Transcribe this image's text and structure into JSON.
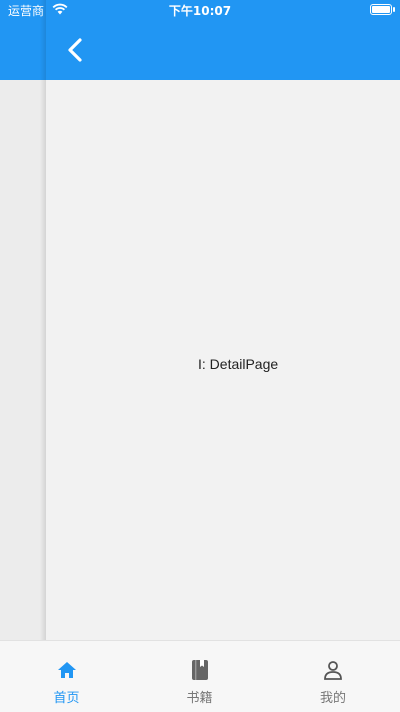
{
  "status_bar": {
    "carrier": "运营商",
    "time": "下午10:07",
    "wifi_icon": "wifi-icon",
    "battery_icon": "battery-icon"
  },
  "app_bar": {
    "back_icon": "chevron-left-icon",
    "color": "#2196f3"
  },
  "content": {
    "text": "I: DetailPage"
  },
  "bottom_nav": {
    "accent_color": "#2196f3",
    "inactive_color": "#777777",
    "items": [
      {
        "label": "首页",
        "icon": "home-icon",
        "active": true
      },
      {
        "label": "书籍",
        "icon": "book-icon",
        "active": false
      },
      {
        "label": "我的",
        "icon": "person-icon",
        "active": false
      }
    ]
  }
}
